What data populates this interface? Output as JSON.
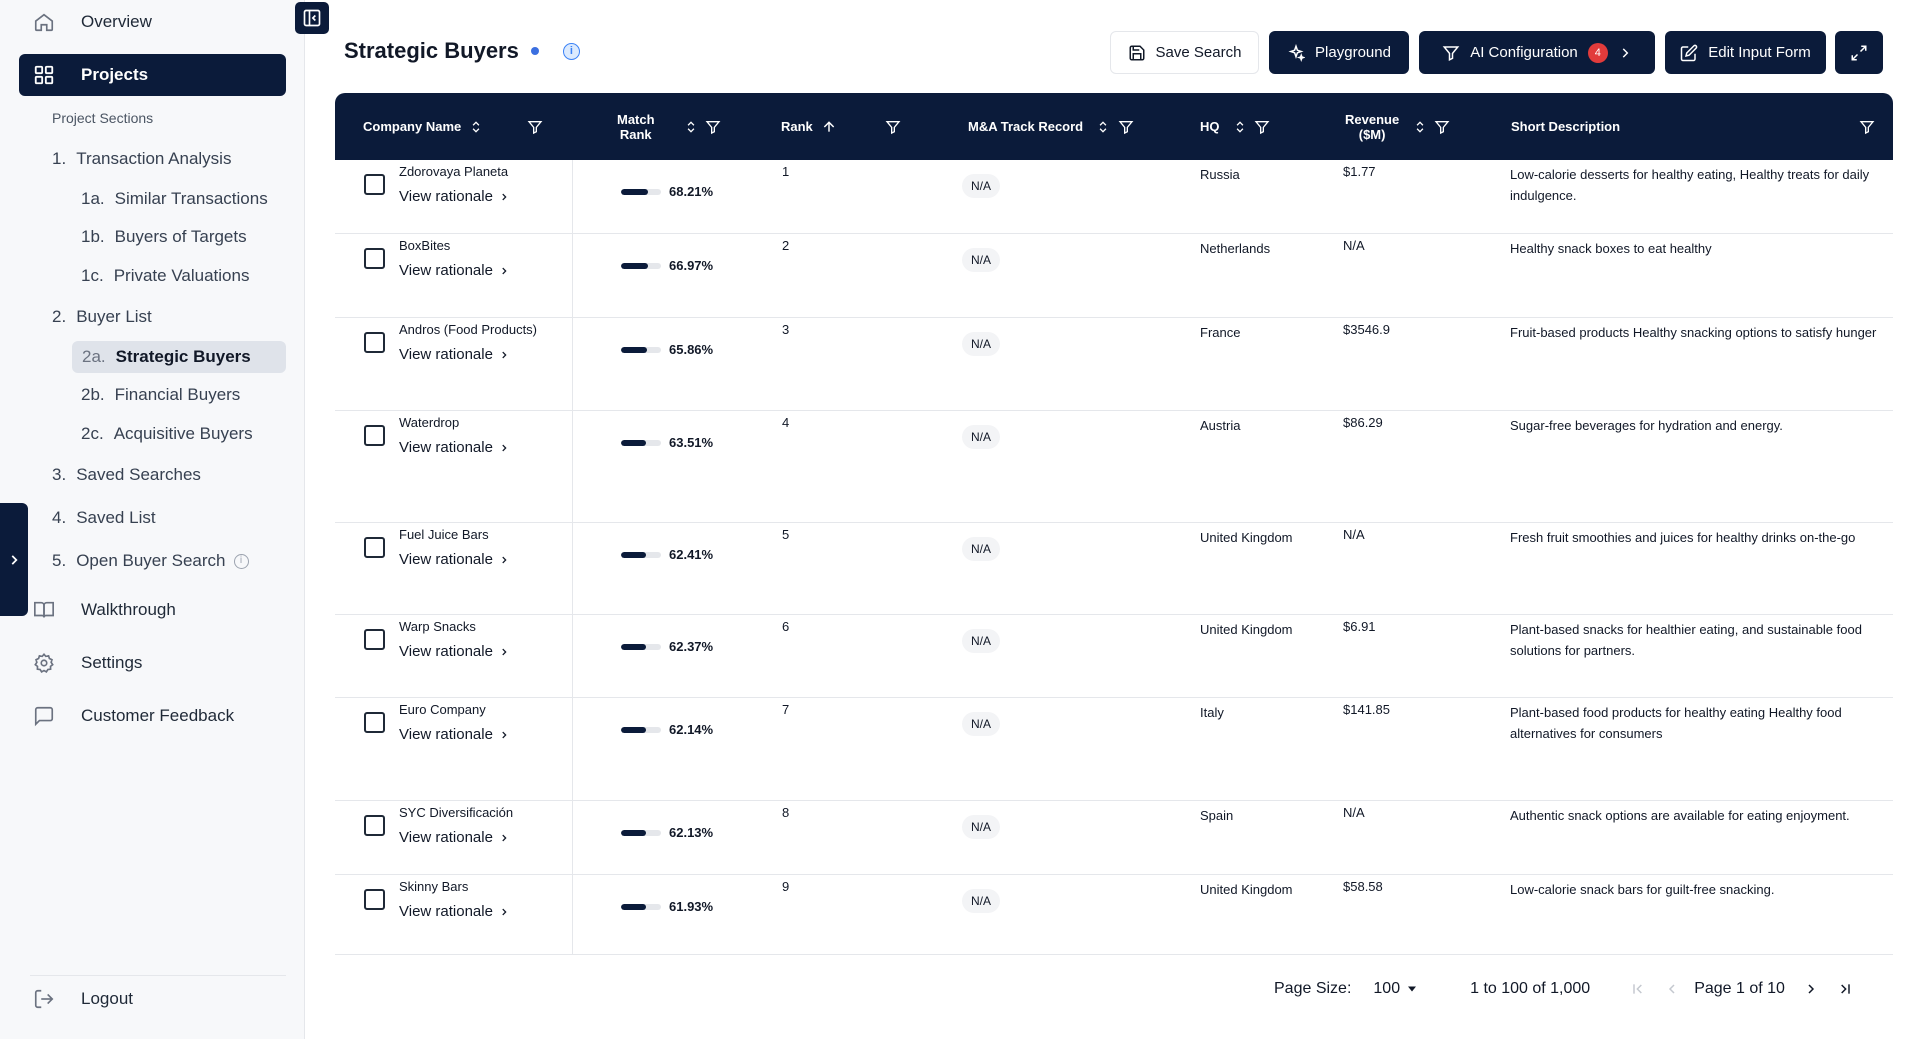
{
  "sidebar": {
    "overview": "Overview",
    "projects": "Projects",
    "section_label": "Project Sections",
    "sections": [
      {
        "num": "1.",
        "label": "Transaction Analysis"
      },
      {
        "num": "1a.",
        "label": "Similar Transactions"
      },
      {
        "num": "1b.",
        "label": "Buyers of Targets"
      },
      {
        "num": "1c.",
        "label": "Private Valuations"
      },
      {
        "num": "2.",
        "label": "Buyer List"
      },
      {
        "num": "2a.",
        "label": "Strategic Buyers"
      },
      {
        "num": "2b.",
        "label": "Financial Buyers"
      },
      {
        "num": "2c.",
        "label": "Acquisitive Buyers"
      },
      {
        "num": "3.",
        "label": "Saved Searches"
      },
      {
        "num": "4.",
        "label": "Saved List"
      },
      {
        "num": "5.",
        "label": "Open Buyer Search"
      }
    ],
    "walkthrough": "Walkthrough",
    "settings": "Settings",
    "feedback": "Customer Feedback",
    "logout": "Logout"
  },
  "header": {
    "title": "Strategic Buyers",
    "save_search": "Save Search",
    "playground": "Playground",
    "ai_config": "AI Configuration",
    "ai_badge": "4",
    "edit_form": "Edit Input Form"
  },
  "table": {
    "columns": {
      "company": "Company Name",
      "match_line1": "Match",
      "match_line2": "Rank",
      "rank": "Rank",
      "ma": "M&A Track Record",
      "hq": "HQ",
      "rev_line1": "Revenue",
      "rev_line2": "($M)",
      "desc": "Short Description"
    },
    "rationale_label": "View rationale",
    "rows": [
      {
        "name": "Zdorovaya Planeta",
        "match": "68.21%",
        "match_frac": 0.6821,
        "rank": "1",
        "ma": "N/A",
        "hq": "Russia",
        "rev": "$1.77",
        "desc": "Low-calorie desserts for healthy eating, Healthy treats for daily indulgence."
      },
      {
        "name": "BoxBites",
        "match": "66.97%",
        "match_frac": 0.6697,
        "rank": "2",
        "ma": "N/A",
        "hq": "Netherlands",
        "rev": "N/A",
        "desc": "Healthy snack boxes to eat healthy"
      },
      {
        "name": "Andros (Food Products)",
        "match": "65.86%",
        "match_frac": 0.6586,
        "rank": "3",
        "ma": "N/A",
        "hq": "France",
        "rev": "$3546.9",
        "desc": "Fruit-based products Healthy snacking options to satisfy hunger"
      },
      {
        "name": "Waterdrop",
        "match": "63.51%",
        "match_frac": 0.6351,
        "rank": "4",
        "ma": "N/A",
        "hq": "Austria",
        "rev": "$86.29",
        "desc": "Sugar-free beverages for hydration and energy."
      },
      {
        "name": "Fuel Juice Bars",
        "match": "62.41%",
        "match_frac": 0.6241,
        "rank": "5",
        "ma": "N/A",
        "hq": "United Kingdom",
        "rev": "N/A",
        "desc": "Fresh fruit smoothies and juices for healthy drinks on-the-go"
      },
      {
        "name": "Warp Snacks",
        "match": "62.37%",
        "match_frac": 0.6237,
        "rank": "6",
        "ma": "N/A",
        "hq": "United Kingdom",
        "rev": "$6.91",
        "desc": "Plant-based snacks for healthier eating, and sustainable food solutions for partners."
      },
      {
        "name": "Euro Company",
        "match": "62.14%",
        "match_frac": 0.6214,
        "rank": "7",
        "ma": "N/A",
        "hq": "Italy",
        "rev": "$141.85",
        "desc": "Plant-based food products for healthy eating Healthy food alternatives for consumers"
      },
      {
        "name": "SYC Diversificación",
        "match": "62.13%",
        "match_frac": 0.6213,
        "rank": "8",
        "ma": "N/A",
        "hq": "Spain",
        "rev": "N/A",
        "desc": "Authentic snack options are available for eating enjoyment."
      },
      {
        "name": "Skinny Bars",
        "match": "61.93%",
        "match_frac": 0.6193,
        "rank": "9",
        "ma": "N/A",
        "hq": "United Kingdom",
        "rev": "$58.58",
        "desc": "Low-calorie snack bars for guilt-free snacking."
      }
    ]
  },
  "footer": {
    "page_size_label": "Page Size:",
    "page_size": "100",
    "range": "1 to 100 of 1,000",
    "page": "Page 1 of 10"
  }
}
